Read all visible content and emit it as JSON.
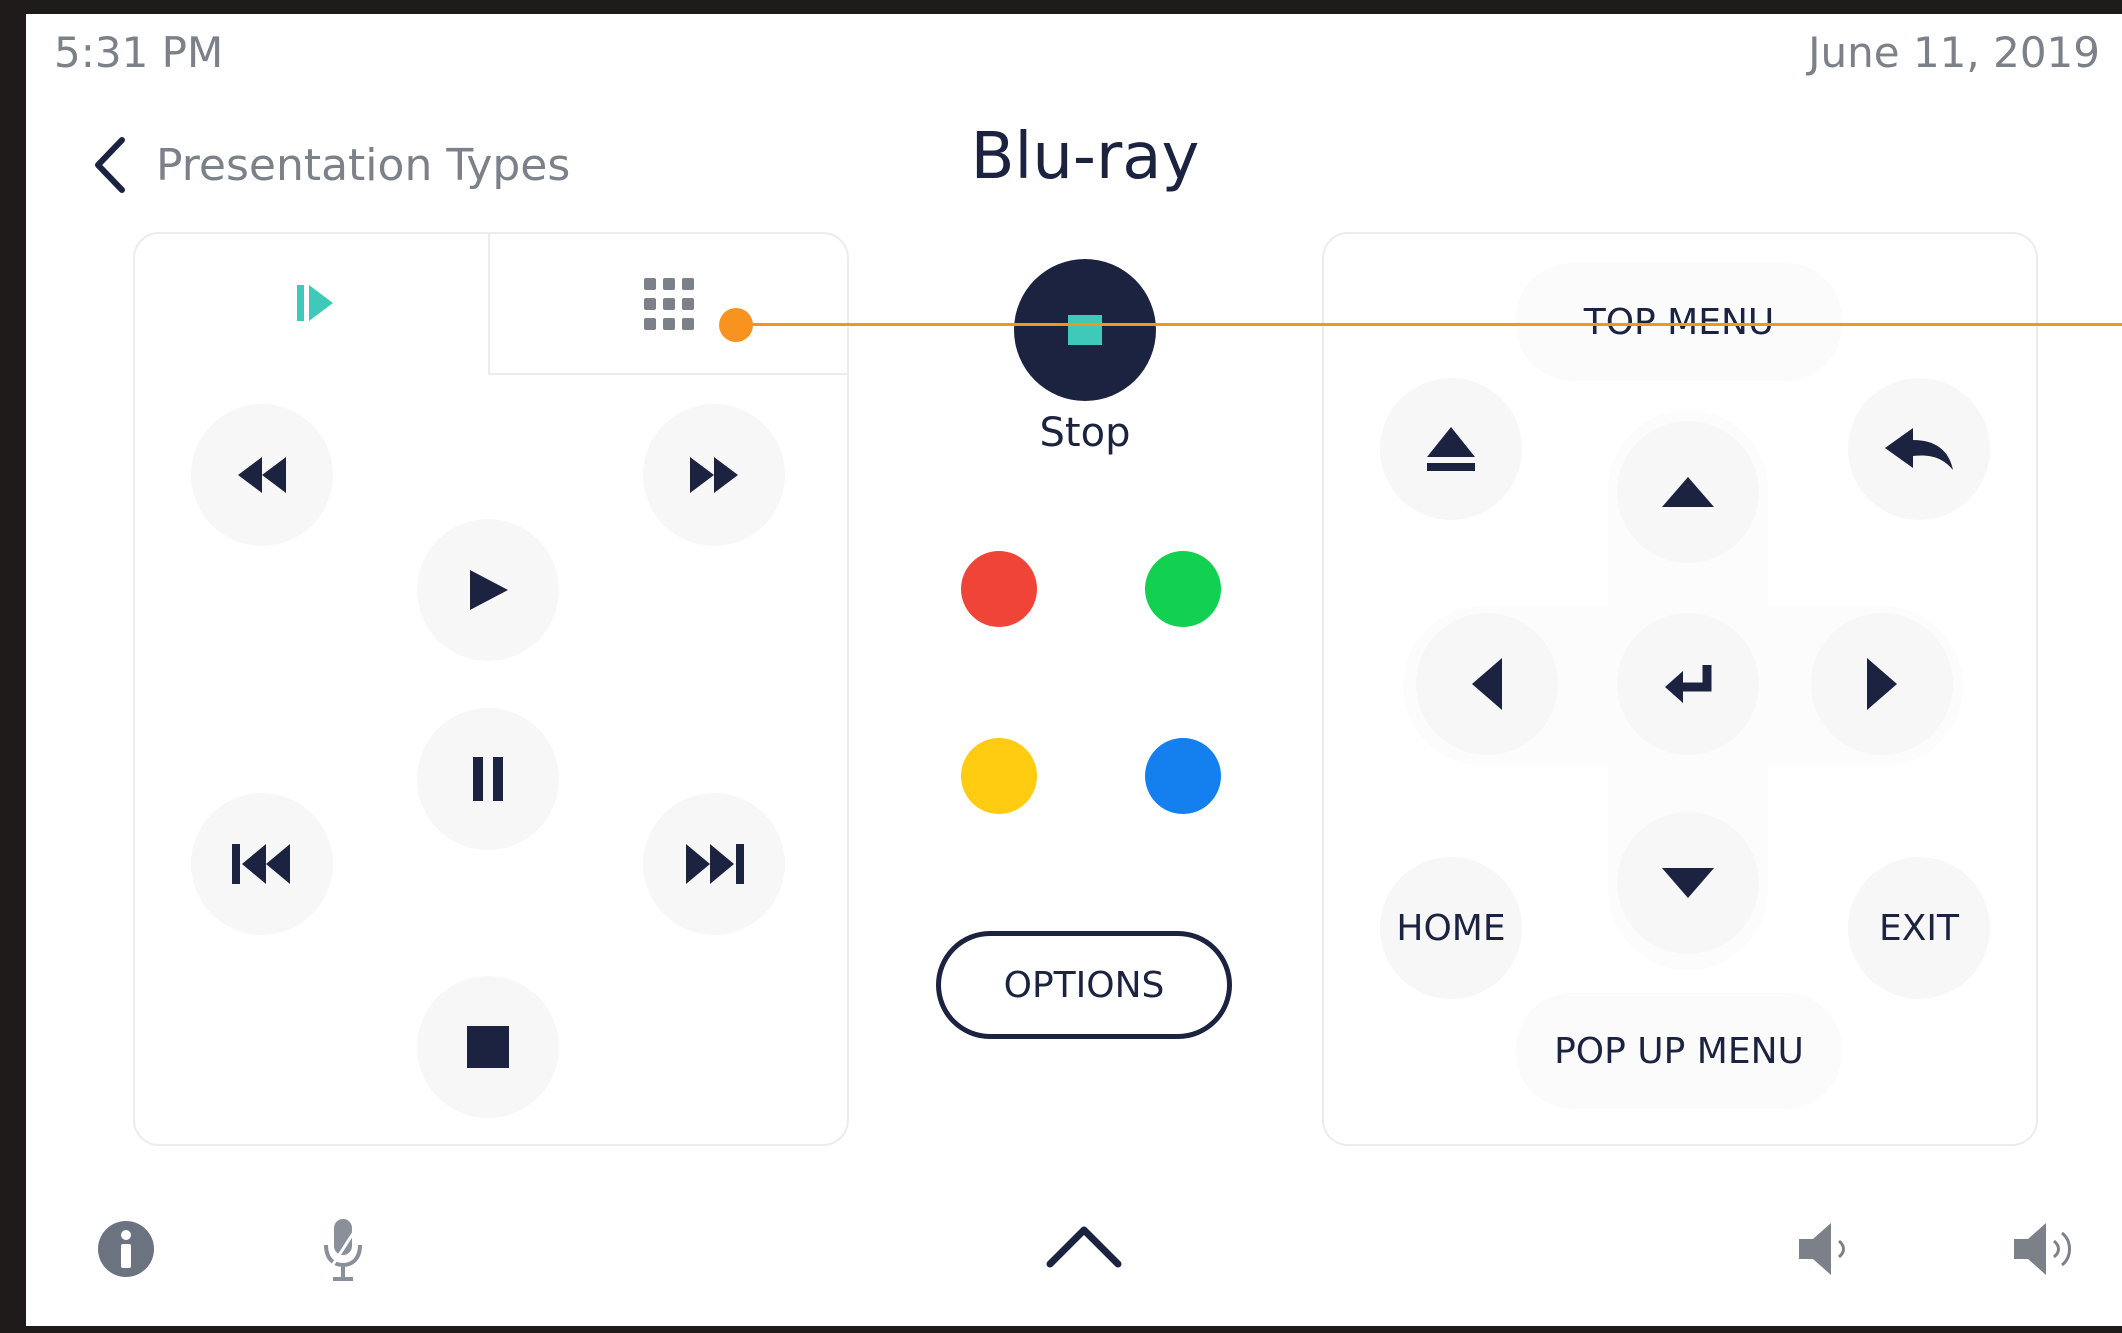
{
  "status": {
    "time": "5:31 PM",
    "date": "June 11, 2019"
  },
  "header": {
    "back_label": "Presentation Types",
    "title": "Blu-ray"
  },
  "left_panel": {
    "tabs": [
      {
        "icon": "transport-icon",
        "active": true
      },
      {
        "icon": "keypad-grid-icon",
        "active": false
      }
    ],
    "buttons": [
      "rewind-icon",
      "fast-forward-icon",
      "play-icon",
      "pause-icon",
      "skip-previous-icon",
      "skip-next-icon",
      "stop-icon"
    ]
  },
  "center": {
    "stop_label": "Stop",
    "color_buttons": [
      {
        "name": "red",
        "color": "#f04438"
      },
      {
        "name": "green",
        "color": "#12d151"
      },
      {
        "name": "yellow",
        "color": "#ffcc12"
      },
      {
        "name": "blue",
        "color": "#1480f0"
      }
    ],
    "options_label": "OPTIONS"
  },
  "right_panel": {
    "top_menu_label": "TOP MENU",
    "home_label": "HOME",
    "exit_label": "EXIT",
    "popup_menu_label": "POP UP MENU",
    "icons": [
      "eject-icon",
      "return-icon",
      "arrow-up-icon",
      "arrow-left-icon",
      "enter-icon",
      "arrow-right-icon",
      "arrow-down-icon"
    ]
  },
  "bottom_bar": {
    "icons": [
      "info-icon",
      "microphone-icon",
      "chevron-up-icon",
      "volume-down-icon",
      "volume-up-icon"
    ]
  },
  "colors": {
    "navy": "#1b2340",
    "accent_teal": "#3fc9b8",
    "annotation_orange": "#f7931e",
    "muted_gray": "#7b8089"
  }
}
